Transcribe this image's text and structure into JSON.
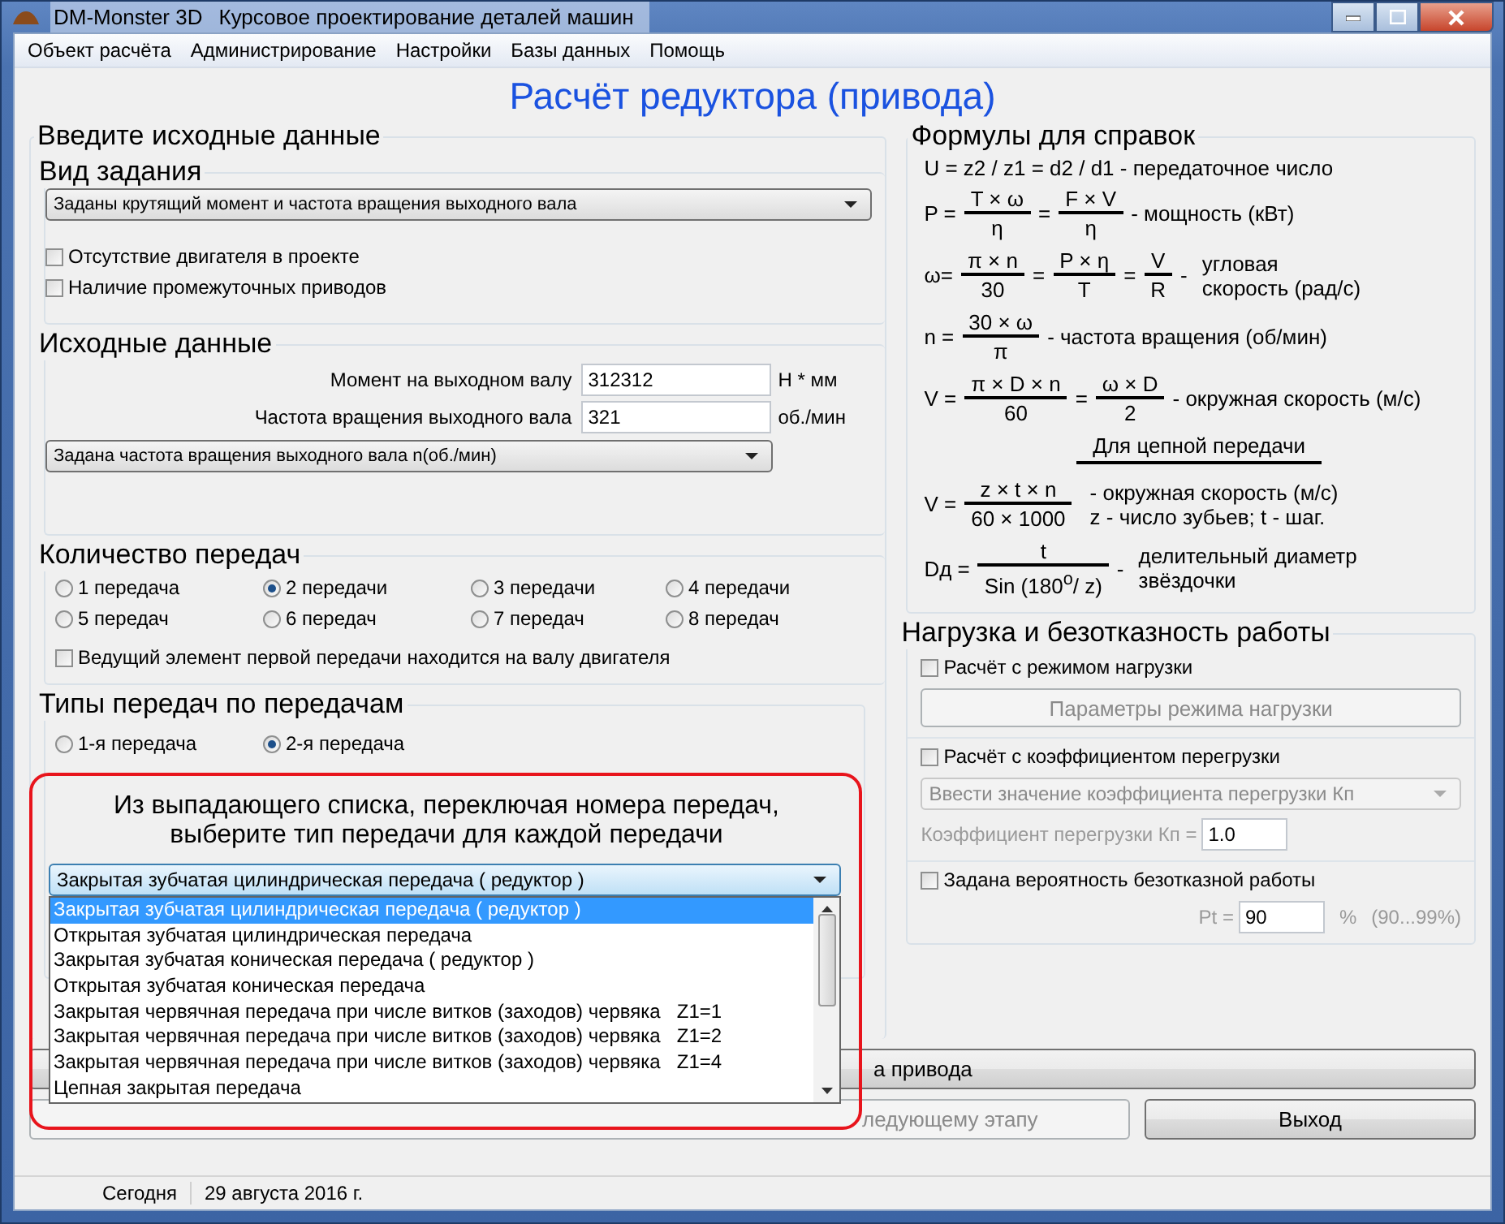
{
  "window": {
    "app_name": "DM-Monster 3D",
    "title": "Курсовое проектирование деталей машин"
  },
  "menu": [
    {
      "label": "Объект расчёта"
    },
    {
      "label": "Администрирование"
    },
    {
      "label": "Настройки"
    },
    {
      "label": "Базы данных"
    },
    {
      "label": "Помощь"
    }
  ],
  "main_title": "Расчёт редуктора (привода)",
  "input_data": {
    "title": "Введите исходные данные",
    "task_type": {
      "title": "Вид задания",
      "select": "Заданы крутящий момент и частота вращения выходного вала",
      "checkboxes": [
        {
          "label": "Отсутствие двигателя в проекте",
          "checked": false
        },
        {
          "label": "Наличие промежуточных приводов",
          "checked": false
        }
      ]
    },
    "source_data": {
      "title": "Исходные данные",
      "fields": [
        {
          "label": "Момент на выходном валу",
          "value": "312312",
          "unit": "Н * мм"
        },
        {
          "label": "Частота вращения выходного вала",
          "value": "321",
          "unit": "об./мин"
        }
      ],
      "select": "Задана частота вращения выходного вала n(об./мин)"
    },
    "gear_count": {
      "title": "Количество передач",
      "options": [
        {
          "label": "1 передача",
          "selected": false
        },
        {
          "label": "2 передачи",
          "selected": true
        },
        {
          "label": "3 передачи",
          "selected": false
        },
        {
          "label": "4 передачи",
          "selected": false
        },
        {
          "label": "5 передач",
          "selected": false
        },
        {
          "label": "6 передач",
          "selected": false
        },
        {
          "label": "7 передач",
          "selected": false
        },
        {
          "label": "8 передач",
          "selected": false
        }
      ],
      "checkbox": {
        "label": "Ведущий элемент первой передачи находится на валу двигателя",
        "checked": false
      }
    },
    "gear_types": {
      "title": "Типы передач по передачам",
      "options": [
        {
          "label": "1-я передача",
          "selected": false
        },
        {
          "label": "2-я передача",
          "selected": true
        }
      ],
      "instruction": "Из выпадающего списка, переключая номера передач,\nвыберите тип передачи для каждой передачи",
      "type_select": {
        "value": "Закрытая зубчатая цилиндрическая передача ( редуктор )",
        "expanded": true,
        "options": [
          {
            "label": "Закрытая зубчатая цилиндрическая передача ( редуктор )",
            "selected": true
          },
          {
            "label": "Открытая зубчатая цилиндрическая передача",
            "selected": false
          },
          {
            "label": "Закрытая зубчатая коническая передача ( редуктор )",
            "selected": false
          },
          {
            "label": "Открытая зубчатая коническая передача",
            "selected": false
          },
          {
            "label": "Закрытая червячная передача при числе витков (заходов) червяка   Z1=1",
            "selected": false
          },
          {
            "label": "Закрытая червячная передача при числе витков (заходов) червяка   Z1=2",
            "selected": false
          },
          {
            "label": "Закрытая червячная передача при числе витков (заходов) червяка   Z1=4",
            "selected": false
          },
          {
            "label": "Цепная закрытая передача",
            "selected": false
          }
        ]
      }
    }
  },
  "formulas": {
    "title": "Формулы для справок",
    "rows": [
      {
        "kind": "text",
        "text": "U = z2 / z1 = d2 / d1 - передаточное число"
      },
      {
        "kind": "formula",
        "parts": [
          {
            "kind": "text",
            "text": "P ="
          },
          {
            "kind": "frac",
            "num": "T × ω",
            "den": "η"
          },
          {
            "kind": "text",
            "text": "="
          },
          {
            "kind": "frac",
            "num": "F × V",
            "den": "η"
          },
          {
            "kind": "text",
            "text": "- мощность (кВт)"
          }
        ]
      },
      {
        "kind": "formula",
        "parts": [
          {
            "kind": "text",
            "text": "ω="
          },
          {
            "kind": "frac",
            "num": "π × n",
            "den": "30"
          },
          {
            "kind": "text",
            "text": "="
          },
          {
            "kind": "frac",
            "num": "P × η",
            "den": "T"
          },
          {
            "kind": "text",
            "text": "="
          },
          {
            "kind": "frac",
            "num": "V",
            "den": "R"
          },
          {
            "kind": "text",
            "text": "-"
          },
          {
            "kind": "lines",
            "lines": [
              "угловая",
              "скорость (рад/с)"
            ]
          }
        ]
      },
      {
        "kind": "formula",
        "parts": [
          {
            "kind": "text",
            "text": "n ="
          },
          {
            "kind": "frac",
            "num": "30 × ω",
            "den": "π"
          },
          {
            "kind": "text",
            "text": "- частота вращения (об/мин)"
          }
        ]
      },
      {
        "kind": "formula",
        "parts": [
          {
            "kind": "text",
            "text": "V ="
          },
          {
            "kind": "frac",
            "num": "π × D × n",
            "den": "60"
          },
          {
            "kind": "text",
            "text": "="
          },
          {
            "kind": "frac",
            "num": "ω × D",
            "den": "2"
          },
          {
            "kind": "text",
            "text": "- окружная скорость (м/с)"
          }
        ]
      },
      {
        "kind": "heading",
        "text": "Для цепной передачи"
      },
      {
        "kind": "formula",
        "parts": [
          {
            "kind": "text",
            "text": "V ="
          },
          {
            "kind": "frac",
            "num": "z × t × n",
            "den": "60 × 1000"
          },
          {
            "kind": "lines",
            "lines": [
              "- окружная скорость (м/с)",
              "z - число зубьев; t - шаг."
            ]
          }
        ]
      },
      {
        "kind": "formula",
        "parts": [
          {
            "kind": "text",
            "text": "Dд ="
          },
          {
            "kind": "frac",
            "num": "t",
            "den": "Sin (180$^{o}$/ z)"
          },
          {
            "kind": "text",
            "text": "-"
          },
          {
            "kind": "lines",
            "lines": [
              "делительный диаметр",
              "звёздочки"
            ]
          }
        ]
      }
    ]
  },
  "load": {
    "title": "Нагрузка и безотказность работы",
    "sections": [
      {
        "checkbox": {
          "label": "Расчёт с режимом нагрузки",
          "checked": false
        },
        "button": {
          "label": "Параметры режима нагрузки",
          "disabled": true
        }
      },
      {
        "checkbox": {
          "label": "Расчёт с коэффициентом перегрузки",
          "checked": false
        },
        "select": {
          "value": "Ввести значение коэффициента перегрузки Кп",
          "disabled": true
        },
        "field": {
          "label": "Коэффициент перегрузки  Кп =",
          "value": "1.0",
          "disabled": true
        }
      },
      {
        "checkbox": {
          "label": "Задана вероятность безотказной работы",
          "checked": false
        },
        "field": {
          "label": "Pt =",
          "value": "90",
          "unit": "%",
          "hint": "(90...99%)",
          "disabled": true
        }
      }
    ]
  },
  "buttons": [
    {
      "label": "а привода",
      "disabled": false
    },
    {
      "label": "ледующему этапу",
      "disabled": true
    },
    {
      "label": "Выход",
      "disabled": false
    }
  ],
  "status_bar": [
    "Сегодня",
    "29 августа 2016 г."
  ]
}
